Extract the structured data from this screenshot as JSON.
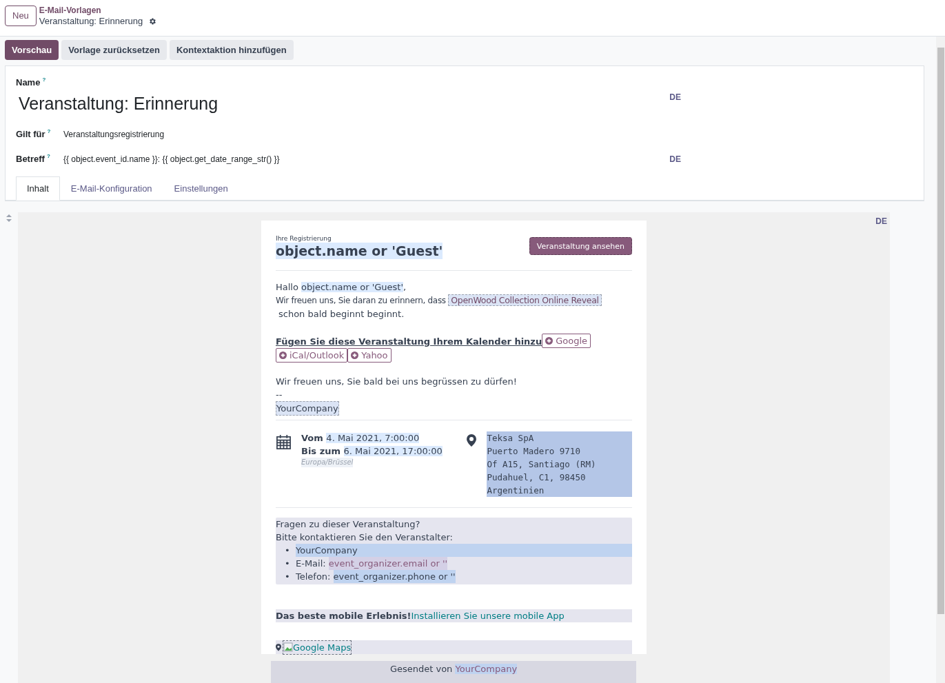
{
  "header": {
    "new_button": "Neu",
    "breadcrumb": "E-Mail-Vorlagen",
    "record_title": "Veranstaltung: Erinnerung"
  },
  "action_buttons": [
    {
      "label": "Vorschau",
      "kind": "primary"
    },
    {
      "label": "Vorlage zurücksetzen",
      "kind": "secondary"
    },
    {
      "label": "Kontextaktion hinzufügen",
      "kind": "secondary"
    }
  ],
  "form": {
    "name_label": "Name",
    "name_help": "?",
    "name_value": "Veranstaltung: Erinnerung",
    "name_lang": "DE",
    "fields": [
      {
        "label": "Gilt für",
        "help": "?",
        "value": "Veranstaltungsregistrierung"
      },
      {
        "label": "Betreff",
        "help": "?",
        "value": "{{ object.event_id.name }}: {{ object.get_date_range_str() }}",
        "lang": "DE"
      }
    ]
  },
  "tabs": [
    {
      "label": "Inhalt",
      "selected": true
    },
    {
      "label": "E-Mail-Konfiguration",
      "selected": false
    },
    {
      "label": "Einstellungen",
      "selected": false
    }
  ],
  "editor": {
    "lang": "DE",
    "email": {
      "kicker": "Ihre Registrierung",
      "title": "object.name or 'Guest'",
      "view_button": "Veranstaltung ansehen",
      "greeting": "Hallo",
      "greeting_name": "object.name or 'Guest'",
      "greeting_end": ",",
      "reminder_start": "Wir freuen uns, Sie daran zu erinnern, dass",
      "event_name": "OpenWood Collection Online Reveal",
      "reminder_end": "schon bald beginnt beginnt.",
      "calendar_label": "Fügen Sie diese Veranstaltung Ihrem Kalender hinzu",
      "calendar_buttons": [
        "Google",
        "iCal/Outlook",
        "Yahoo"
      ],
      "closing": "Wir freuen uns, Sie bald bei uns begrüssen zu dürfen!",
      "signature_sep": "--",
      "signature": "YourCompany",
      "from_label": "Vom",
      "from_value": "4. Mai 2021, 7:00:00",
      "to_label": "Bis zum",
      "to_value": "6. Mai 2021, 17:00:00",
      "timezone": "Europa/Brüssel",
      "address": [
        "Teksa SpA",
        "Puerto Madero 9710",
        "Of A15, Santiago (RM)",
        "Pudahuel, C1, 98450",
        "Argentinien"
      ],
      "questions": "Fragen zu dieser Veranstaltung?",
      "contact_intro": "Bitte kontaktieren Sie den Veranstalter:",
      "contacts": [
        {
          "kind": "name",
          "bullet": "•",
          "value": "YourCompany"
        },
        {
          "kind": "email",
          "bullet": "•",
          "label": "E-Mail:",
          "value": "event_organizer.email or ''"
        },
        {
          "kind": "phone",
          "bullet": "•",
          "label": "Telefon:",
          "value": "event_organizer.phone or ''"
        }
      ],
      "mobile_label": "Das beste mobile Erlebnis!",
      "mobile_link": "Installieren Sie unsere mobile App",
      "maps_link": "Google Maps",
      "footer_label": "Gesendet von",
      "footer_company": "YourCompany"
    }
  }
}
